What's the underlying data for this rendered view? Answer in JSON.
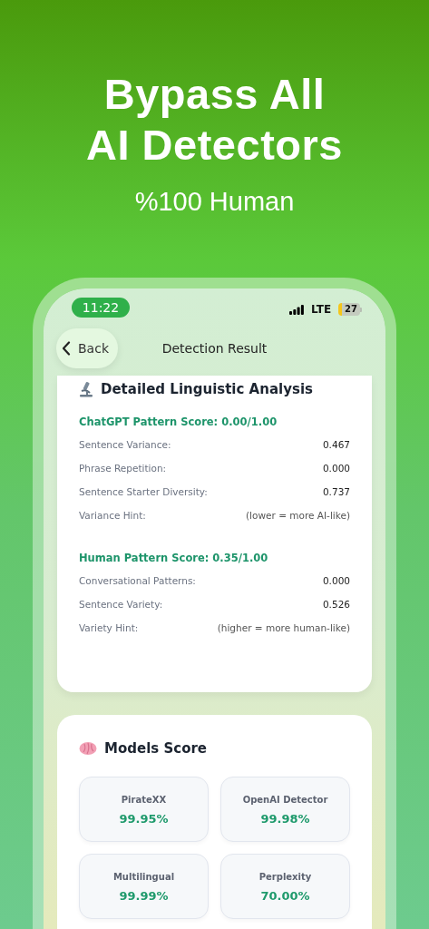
{
  "headline": {
    "lines": [
      "Bypass All",
      "AI Detectors"
    ],
    "subtitle": "%100 Human"
  },
  "status_bar": {
    "time": "11:22",
    "network": "LTE",
    "battery": "27"
  },
  "nav": {
    "back": "Back",
    "title": "Detection Result"
  },
  "analysis": {
    "title": "Detailed Linguistic Analysis",
    "sections": [
      {
        "heading": "ChatGPT Pattern Score: 0.00/1.00",
        "rows": [
          {
            "label": "Sentence Variance:",
            "value": "0.467",
            "kind": "value"
          },
          {
            "label": "Phrase Repetition:",
            "value": "0.000",
            "kind": "value"
          },
          {
            "label": "Sentence Starter Diversity:",
            "value": "0.737",
            "kind": "value"
          },
          {
            "label": "Variance Hint:",
            "value": "(lower = more AI-like)",
            "kind": "hint"
          }
        ]
      },
      {
        "heading": "Human Pattern Score: 0.35/1.00",
        "rows": [
          {
            "label": "Conversational Patterns:",
            "value": "0.000",
            "kind": "value"
          },
          {
            "label": "Sentence Variety:",
            "value": "0.526",
            "kind": "value"
          },
          {
            "label": "Variety Hint:",
            "value": "(higher = more human-like)",
            "kind": "hint"
          }
        ]
      }
    ]
  },
  "models": {
    "title": "Models Score",
    "tiles": [
      {
        "name": "PirateXX",
        "score": "99.95%"
      },
      {
        "name": "OpenAI Detector",
        "score": "99.98%"
      },
      {
        "name": "Multilingual",
        "score": "99.99%"
      },
      {
        "name": "Perplexity",
        "score": "70.00%"
      }
    ]
  }
}
